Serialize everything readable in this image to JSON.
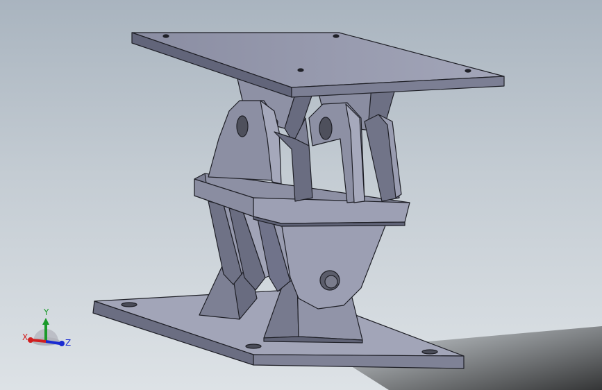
{
  "triad": {
    "x_label": "X",
    "y_label": "Y",
    "z_label": "Z"
  },
  "colors": {
    "bg_top": "#a9b4bf",
    "bg_bottom": "#dde2e6",
    "part_light": "#9ea0b4",
    "part_mid": "#7f8298",
    "part_dark": "#5f6276",
    "edge": "#1e1f26",
    "x_axis": "#d11f1f",
    "y_axis": "#1a9a2a",
    "z_axis": "#1a2bd1"
  },
  "icons": {
    "triad": "coordinate-triad-icon"
  }
}
